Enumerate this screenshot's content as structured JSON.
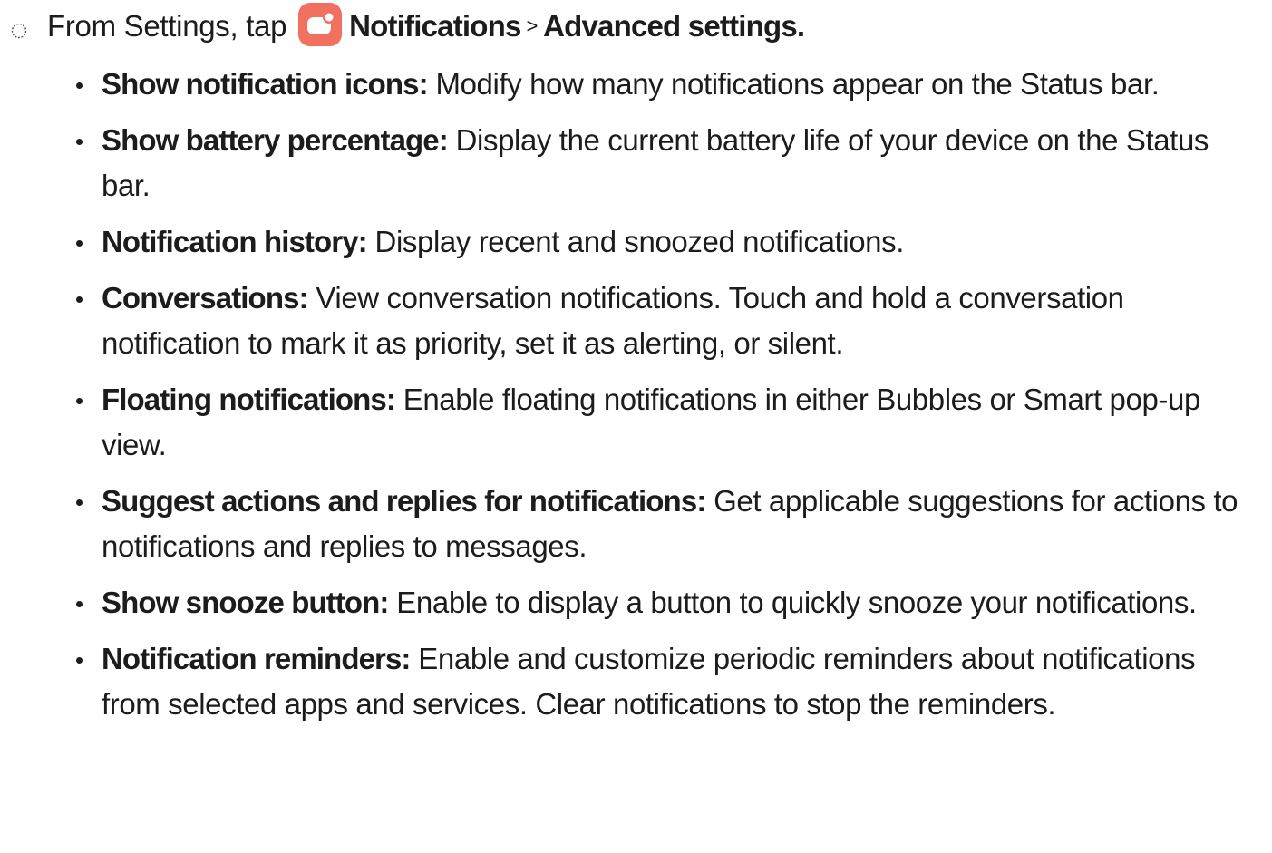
{
  "step": {
    "prefix": "From Settings, tap",
    "app_icon": "notifications-app-icon",
    "app_icon_color": "#f1705f",
    "menu": "Notifications",
    "separator": ">",
    "submenu": "Advanced settings",
    "suffix": "."
  },
  "items": [
    {
      "term": "Show notification icons:",
      "desc": "Modify how many notifications appear on the Status bar."
    },
    {
      "term": "Show battery percentage:",
      "desc": "Display the current battery life of your device on the Status bar."
    },
    {
      "term": "Notification history:",
      "desc": "Display recent and snoozed notifications."
    },
    {
      "term": "Conversations:",
      "desc": "View conversation notifications. Touch and hold a conversation notification to mark it as priority, set it as alerting, or silent."
    },
    {
      "term": "Floating notifications:",
      "desc": "Enable floating notifications in either Bubbles or Smart pop-up view."
    },
    {
      "term": "Suggest actions and replies for notifications:",
      "desc": "Get applicable suggestions for actions to notifications and replies to messages."
    },
    {
      "term": "Show snooze button:",
      "desc": "Enable to display a button to quickly snooze your notifications."
    },
    {
      "term": "Notification reminders:",
      "desc": "Enable and customize periodic reminders about notifications from selected apps and services. Clear notifications to stop the reminders."
    }
  ]
}
